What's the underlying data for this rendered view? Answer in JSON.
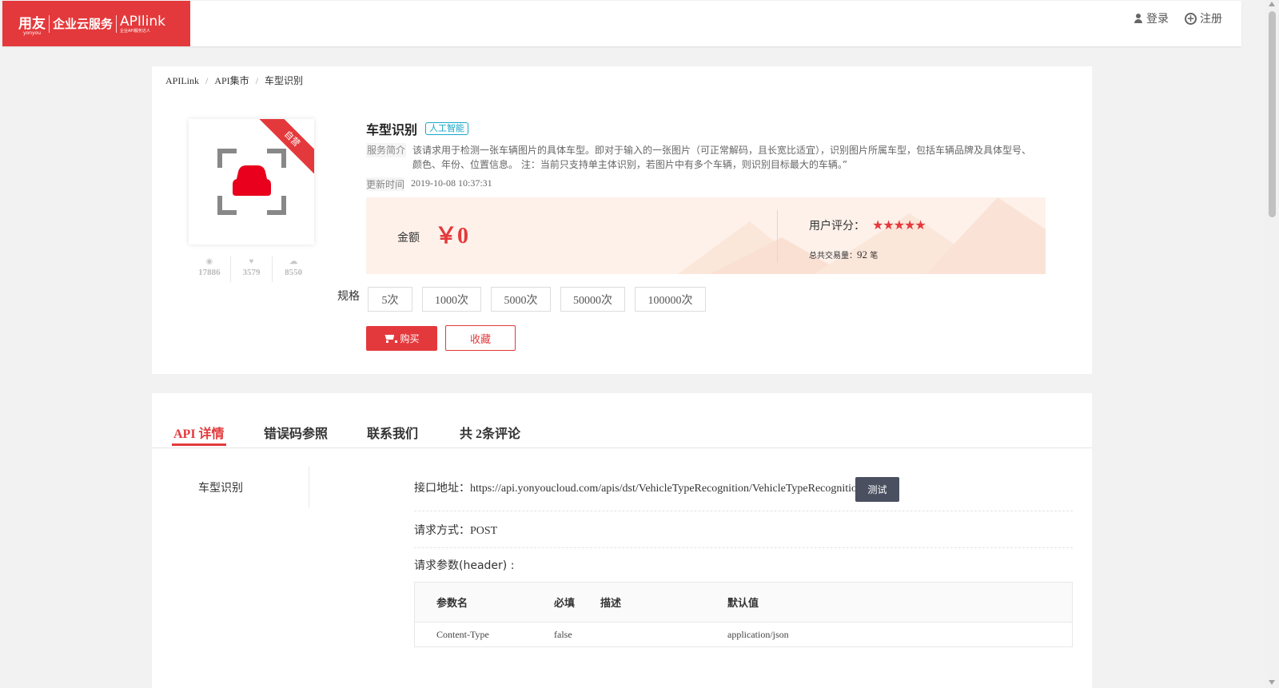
{
  "header": {
    "brand": "用友",
    "brand_sub": "yonyou",
    "product": "企业云服务",
    "apilink": "APIlink",
    "apilink_sub": "企业API服务达人",
    "login": "登录",
    "register": "注册"
  },
  "breadcrumb": [
    "APILink",
    "API集市",
    "车型识别"
  ],
  "product": {
    "ribbon": "自营",
    "stats": [
      {
        "icon": "eye-icon",
        "value": "17886"
      },
      {
        "icon": "heart-icon",
        "value": "3579"
      },
      {
        "icon": "cloud-icon",
        "value": "8550"
      }
    ],
    "title": "车型识别",
    "tag": "人工智能",
    "intro_label": "服务简介",
    "intro_text": "该请求用于检测一张车辆图片的具体车型。即对于输入的一张图片（可正常解码，且长宽比适宜），识别图片所属车型，包括车辆品牌及具体型号、颜色、年份、位置信息。 注：当前只支持单主体识别，若图片中有多个车辆，则识别目标最大的车辆。”",
    "update_label": "更新时间",
    "update_value": "2019-10-08 10:37:31",
    "price_label": "金额",
    "price_value": "￥0",
    "rating_label": "用户评分：",
    "rating_stars": 5,
    "stars_text": "★★★★★",
    "trade_label": "总共交易量：",
    "trade_value": "92",
    "trade_unit": "笔",
    "spec_label": "规格",
    "specs": [
      "5次",
      "1000次",
      "5000次",
      "50000次",
      "100000次"
    ],
    "buy_label": "购买",
    "fav_label": "收藏"
  },
  "detail": {
    "tabs": [
      "API 详情",
      "错误码参照",
      "联系我们",
      "共 2条评论"
    ],
    "side_item": "车型识别",
    "endpoint_label": "接口地址：",
    "endpoint_value": "https://api.yonyoucloud.com/apis/dst/VehicleTypeRecognition/VehicleTypeRecognition",
    "test_label": "测试",
    "method_label": "请求方式：",
    "method_value": "POST",
    "params_label": "请求参数(header) :",
    "table_headers": [
      "参数名",
      "必填",
      "描述",
      "默认值"
    ],
    "table_rows": [
      [
        "Content-Type",
        "false",
        "",
        "application/json"
      ]
    ]
  },
  "colors": {
    "accent": "#e4393c",
    "tag": "#17a8c8",
    "price_bg": "#fdf1ea",
    "test_button": "#4a5060"
  }
}
